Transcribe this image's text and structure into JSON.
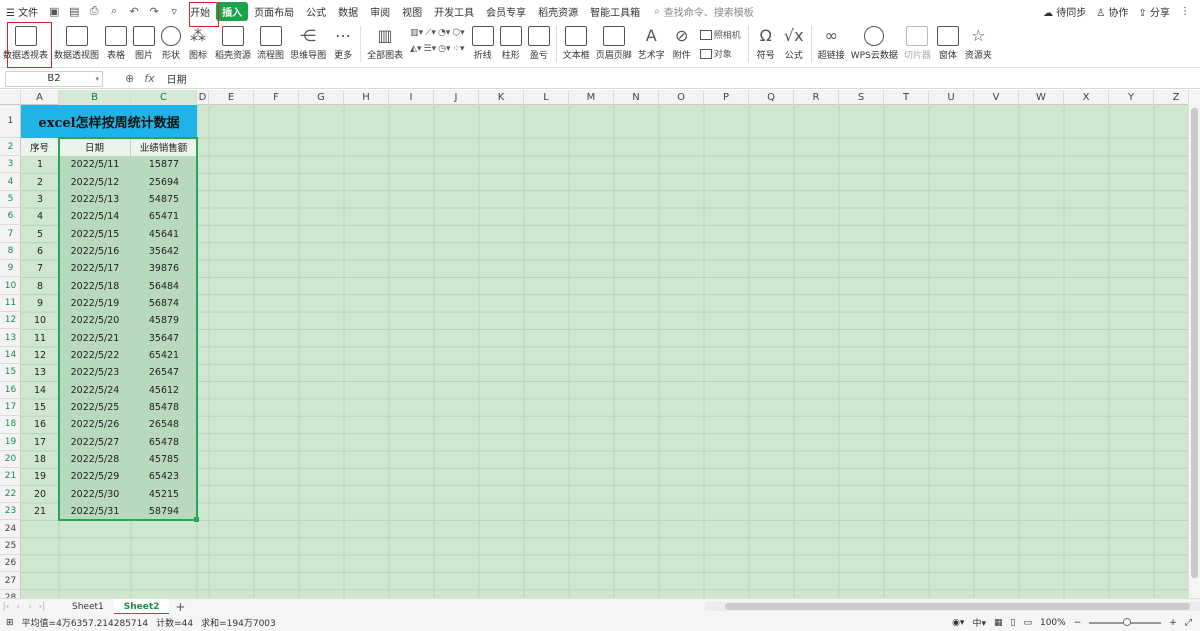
{
  "menubar": {
    "hamburger": "☰",
    "file_label": "文件",
    "tabs": [
      "开始",
      "插入",
      "页面布局",
      "公式",
      "数据",
      "审阅",
      "视图",
      "开发工具",
      "会员专享",
      "稻壳资源",
      "智能工具箱"
    ],
    "active_tab": "插入",
    "search_placeholder": "查找命令、搜索模板",
    "sync_label": "待同步",
    "collab_label": "协作",
    "share_label": "分享"
  },
  "ribbon": {
    "buttons": [
      "数据透视表",
      "数据透视图",
      "表格",
      "图片",
      "形状",
      "图标",
      "稻壳资源",
      "流程图",
      "思维导图",
      "更多",
      "全部图表",
      "折线",
      "柱形",
      "盈亏",
      "文本框",
      "页眉页脚",
      "艺术字",
      "附件",
      "照相机",
      "对象",
      "符号",
      "公式",
      "超链接",
      "WPS云数据",
      "切片器",
      "窗体",
      "资源夹"
    ]
  },
  "formula_bar": {
    "cell_ref": "B2",
    "fx_symbol": "fx",
    "value": "日期"
  },
  "grid": {
    "columns": [
      "A",
      "B",
      "C",
      "D",
      "E",
      "F",
      "G",
      "H",
      "I",
      "J",
      "K",
      "L",
      "M",
      "N",
      "O",
      "P",
      "Q",
      "R",
      "S",
      "T",
      "U",
      "V",
      "W",
      "X",
      "Y",
      "Z"
    ],
    "selected_columns": [
      "B",
      "C"
    ],
    "row_numbers": [
      "1",
      "2",
      "3",
      "4",
      "5",
      "6",
      "7",
      "8",
      "9",
      "10",
      "11",
      "12",
      "13",
      "14",
      "15",
      "16",
      "17",
      "18",
      "19",
      "20",
      "21",
      "22",
      "23",
      "24",
      "25",
      "26",
      "27",
      "28"
    ],
    "selected_rows_from": 2,
    "selected_rows_to": 23,
    "title": "excel怎样按周统计数据",
    "headers": [
      "序号",
      "日期",
      "业绩销售额"
    ],
    "rows": [
      [
        "1",
        "2022/5/11",
        "15877"
      ],
      [
        "2",
        "2022/5/12",
        "25694"
      ],
      [
        "3",
        "2022/5/13",
        "54875"
      ],
      [
        "4",
        "2022/5/14",
        "65471"
      ],
      [
        "5",
        "2022/5/15",
        "45641"
      ],
      [
        "6",
        "2022/5/16",
        "35642"
      ],
      [
        "7",
        "2022/5/17",
        "39876"
      ],
      [
        "8",
        "2022/5/18",
        "56484"
      ],
      [
        "9",
        "2022/5/19",
        "56874"
      ],
      [
        "10",
        "2022/5/20",
        "45879"
      ],
      [
        "11",
        "2022/5/21",
        "35647"
      ],
      [
        "12",
        "2022/5/22",
        "65421"
      ],
      [
        "13",
        "2022/5/23",
        "26547"
      ],
      [
        "14",
        "2022/5/24",
        "45612"
      ],
      [
        "15",
        "2022/5/25",
        "85478"
      ],
      [
        "16",
        "2022/5/26",
        "26548"
      ],
      [
        "17",
        "2022/5/27",
        "65478"
      ],
      [
        "18",
        "2022/5/28",
        "45785"
      ],
      [
        "19",
        "2022/5/29",
        "65423"
      ],
      [
        "20",
        "2022/5/30",
        "45215"
      ],
      [
        "21",
        "2022/5/31",
        "58794"
      ]
    ]
  },
  "sheets": {
    "tabs": [
      "Sheet1",
      "Sheet2"
    ],
    "active": "Sheet2",
    "add": "+"
  },
  "status": {
    "average": "平均值=4万6357.214285714",
    "count": "计数=44",
    "sum": "求和=194万7003",
    "zoom": "100%",
    "zoom_minus": "−",
    "zoom_plus": "+"
  },
  "colors": {
    "accent": "#1ba34a",
    "title_fill": "#20b3e8",
    "grid_fill": "#cfe7cf",
    "selection_border": "#26a65b",
    "highlight_box": "#e02020"
  }
}
